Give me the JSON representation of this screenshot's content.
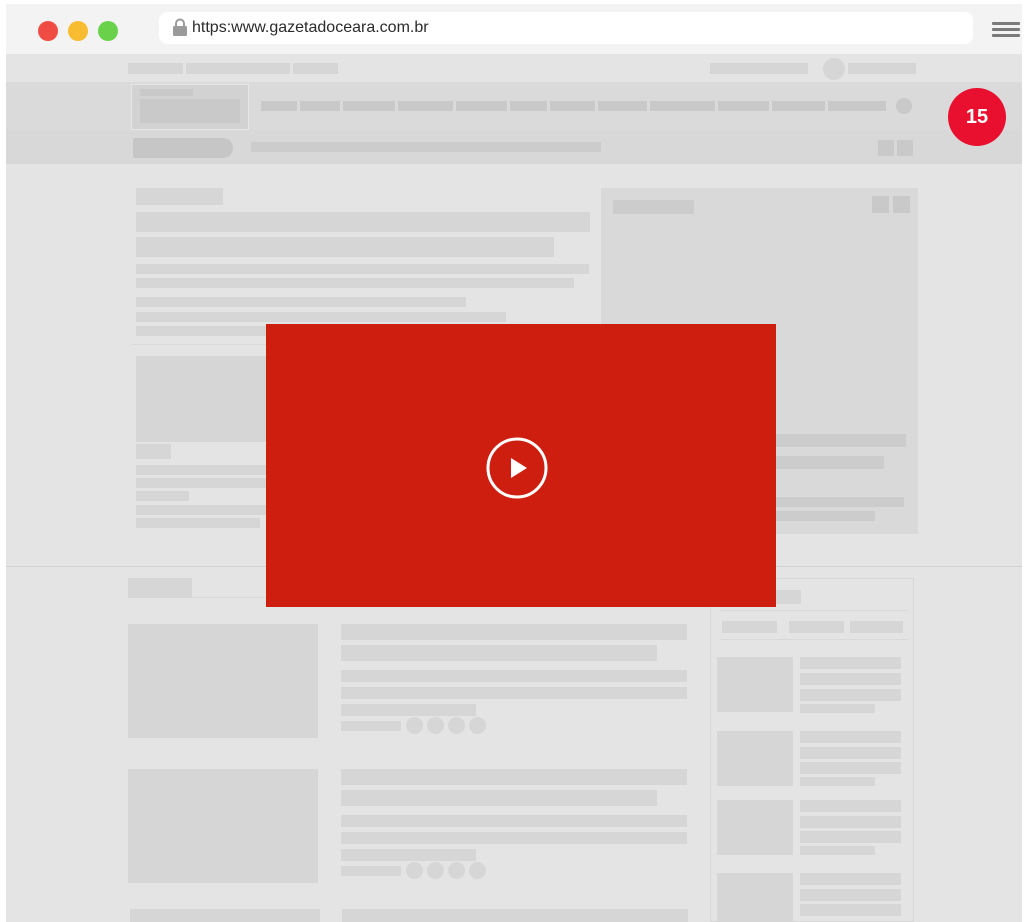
{
  "browser": {
    "url": "https:www.gazetadoceara.com.br",
    "traffic_lights": [
      "#f14c44",
      "#f8bc30",
      "#6ad24a"
    ],
    "icons": [
      "lock-icon",
      "hamburger-menu-icon"
    ]
  },
  "badge": {
    "count": "15",
    "color": "#e8102e"
  },
  "video": {
    "color": "#cd1e10",
    "icon": "play-icon"
  }
}
